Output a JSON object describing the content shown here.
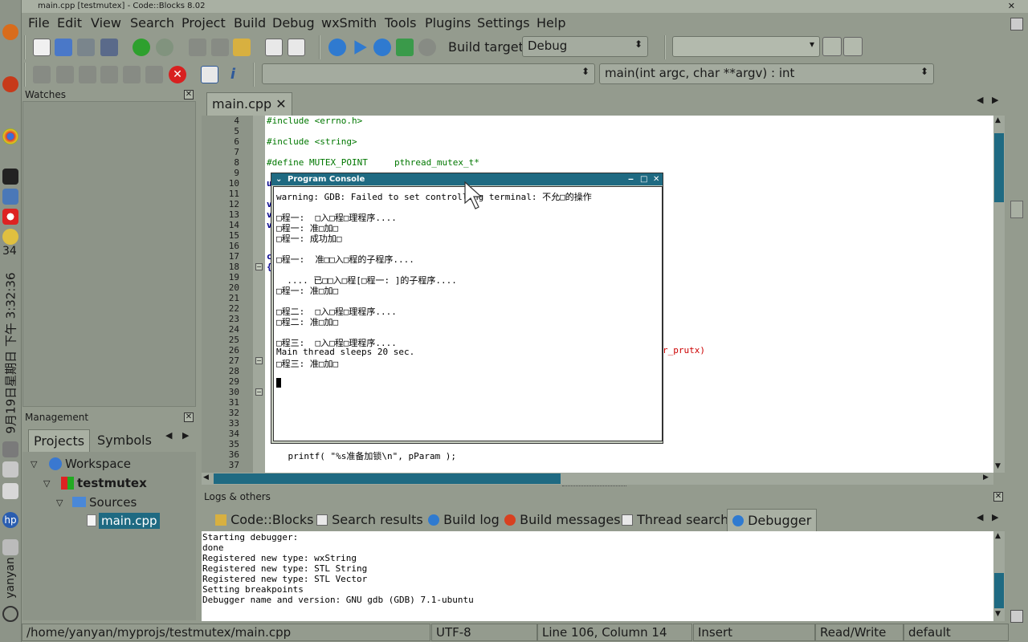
{
  "window": {
    "title": "main.cpp [testmutex] - Code::Blocks 8.02"
  },
  "desktop": {
    "clock": "9月19日星期日 下午 3:32:36",
    "day_num": "34",
    "user": "yanyan"
  },
  "menu": [
    "File",
    "Edit",
    "View",
    "Search",
    "Project",
    "Build",
    "Debug",
    "wxSmith",
    "Tools",
    "Plugins",
    "Settings",
    "Help"
  ],
  "build": {
    "label": "Build target:",
    "value": "Debug"
  },
  "nav": {
    "function": "main(int argc, char **argv) : int",
    "scope": ""
  },
  "watches": {
    "title": "Watches"
  },
  "management": {
    "title": "Management",
    "tabs": [
      "Projects",
      "Symbols"
    ],
    "tree": {
      "workspace": "Workspace",
      "project": "testmutex",
      "folder": "Sources",
      "file": "main.cpp"
    }
  },
  "editor": {
    "tab": "main.cpp",
    "lines": [
      {
        "n": "4",
        "t": "#include <errno.h>"
      },
      {
        "n": "5",
        "t": ""
      },
      {
        "n": "6",
        "t": "#include <string>"
      },
      {
        "n": "7",
        "t": ""
      },
      {
        "n": "8",
        "t": "#define MUTEX_POINT     pthread_mutex_t*"
      },
      {
        "n": "9",
        "t": ""
      },
      {
        "n": "10",
        "t": "u"
      },
      {
        "n": "11",
        "t": ""
      },
      {
        "n": "12",
        "t": "v"
      },
      {
        "n": "13",
        "t": "v"
      },
      {
        "n": "14",
        "t": "v"
      },
      {
        "n": "15",
        "t": ""
      },
      {
        "n": "16",
        "t": ""
      },
      {
        "n": "17",
        "t": "c"
      },
      {
        "n": "18",
        "t": "{"
      },
      {
        "n": "19",
        "t": ""
      },
      {
        "n": "20",
        "t": ""
      },
      {
        "n": "21",
        "t": ""
      },
      {
        "n": "22",
        "t": ""
      },
      {
        "n": "23",
        "t": ""
      },
      {
        "n": "24",
        "t": ""
      },
      {
        "n": "25",
        "t": ""
      },
      {
        "n": "26",
        "t": ""
      },
      {
        "n": "27",
        "t": ""
      },
      {
        "n": "28",
        "t": ""
      },
      {
        "n": "29",
        "t": ""
      },
      {
        "n": "30",
        "t": ""
      },
      {
        "n": "31",
        "t": ""
      },
      {
        "n": "32",
        "t": ""
      },
      {
        "n": "33",
        "t": ""
      },
      {
        "n": "34",
        "t": ""
      },
      {
        "n": "35",
        "t": ""
      },
      {
        "n": "36",
        "t": "    printf( \"%s准备加锁\\n\", pParam );"
      },
      {
        "n": "37",
        "t": ""
      }
    ],
    "fragment": "r_prutx)"
  },
  "console": {
    "title": "Program Console",
    "lines": [
      "warning: GDB: Failed to set controlling terminal: 不允□的操作",
      "",
      "□程一:  □入□程□理程序....",
      "□程一: 准□加□",
      "□程一: 成功加□",
      "",
      "□程一:  准□□入□程的子程序....",
      "",
      "  .... 已□□入□程[□程一: ]的子程序....",
      "□程一: 准□加□",
      "",
      "□程二:  □入□程□理程序....",
      "□程二: 准□加□",
      "",
      "□程三:  □入□程□理程序....",
      "Main thread sleeps 20 sec.",
      "□程三: 准□加□"
    ]
  },
  "logs": {
    "title": "Logs & others",
    "tabs": [
      "Code::Blocks",
      "Search results",
      "Build log",
      "Build messages",
      "Thread search",
      "Debugger"
    ],
    "lines": [
      "Starting debugger:",
      "done",
      "Registered new type: wxString",
      "Registered new type: STL String",
      "Registered new type: STL Vector",
      "Setting breakpoints",
      "Debugger name and version: GNU gdb (GDB) 7.1-ubuntu"
    ]
  },
  "status": {
    "path": "/home/yanyan/myprojs/testmutex/main.cpp",
    "encoding": "UTF-8",
    "position": "Line 106, Column 14",
    "mode": "Insert",
    "access": "Read/Write",
    "profile": "default"
  }
}
